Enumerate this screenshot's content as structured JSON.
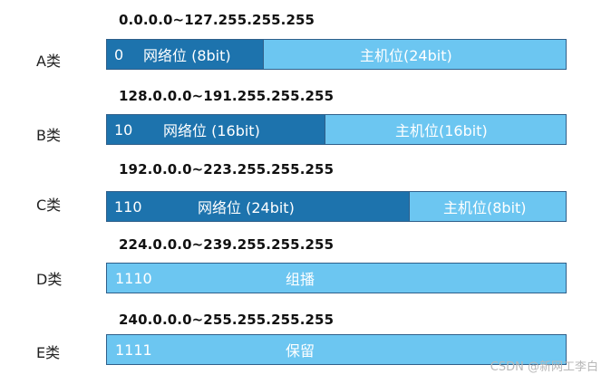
{
  "rows": [
    {
      "class_label": "A类",
      "range": "0.0.0.0~127.255.255.255",
      "prefix": "0",
      "network": "网络位 (8bit)",
      "host": "主机位(24bit)"
    },
    {
      "class_label": "B类",
      "range": "128.0.0.0~191.255.255.255",
      "prefix": "10",
      "network": "网络位 (16bit)",
      "host": "主机位(16bit)"
    },
    {
      "class_label": "C类",
      "range": "192.0.0.0~223.255.255.255",
      "prefix": "110",
      "network": "网络位 (24bit)",
      "host": "主机位(8bit)"
    },
    {
      "class_label": "D类",
      "range": "224.0.0.0~239.255.255.255",
      "prefix": "1110",
      "purpose": "组播"
    },
    {
      "class_label": "E类",
      "range": "240.0.0.0~255.255.255.255",
      "prefix": "1111",
      "purpose": "保留"
    }
  ],
  "colors": {
    "network": "#1d73ad",
    "host": "#6cc6f1",
    "border": "#2f5f8a"
  },
  "watermark": "CSDN @新网工李白"
}
